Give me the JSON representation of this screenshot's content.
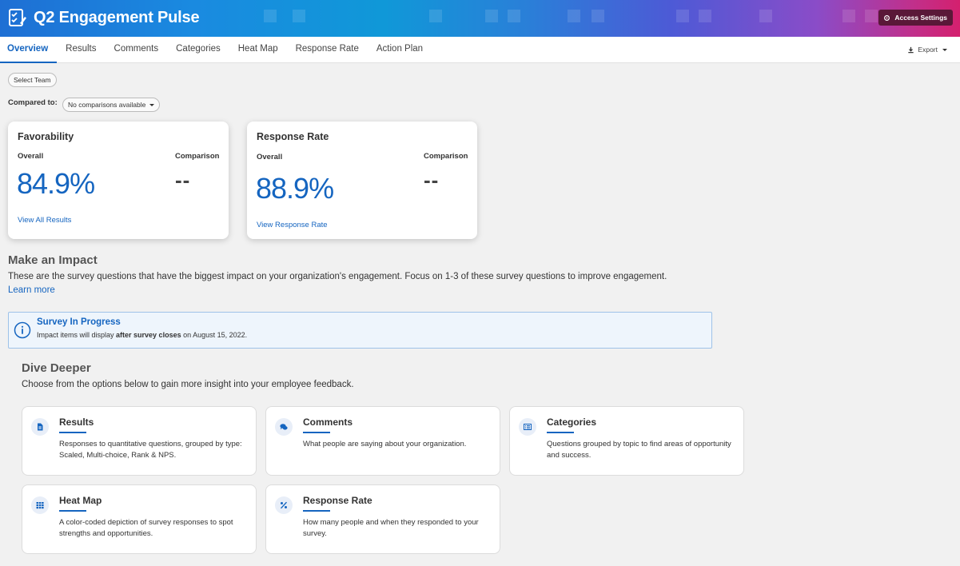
{
  "header": {
    "title": "Q2 Engagement Pulse",
    "logo_icon": "survey-check-icon",
    "access_settings_label": "Access Settings",
    "gradient_colors": [
      "#1e6fd4",
      "#1098d8",
      "#4d5ad6",
      "#8a4cc8",
      "#d4206e"
    ]
  },
  "nav": {
    "tabs": [
      {
        "label": "Overview",
        "active": true
      },
      {
        "label": "Results"
      },
      {
        "label": "Comments"
      },
      {
        "label": "Categories"
      },
      {
        "label": "Heat Map"
      },
      {
        "label": "Response Rate"
      },
      {
        "label": "Action Plan"
      }
    ],
    "export_label": "Export"
  },
  "controls": {
    "select_team_label": "Select Team",
    "compared_to_label": "Compared to:",
    "comparison_value": "No comparisons available"
  },
  "metrics": {
    "favorability": {
      "title": "Favorability",
      "overall_label": "Overall",
      "comparison_label": "Comparison",
      "overall_value": "84.9%",
      "comparison_value": "--",
      "link_label": "View All Results"
    },
    "response_rate": {
      "title": "Response Rate",
      "overall_label": "Overall",
      "comparison_label": "Comparison",
      "overall_value": "88.9%",
      "comparison_value": "--",
      "link_label": "View Response Rate"
    }
  },
  "impact": {
    "title": "Make an Impact",
    "description": "These are the survey questions that have the biggest impact on your organization's engagement. Focus on 1-3 of these survey questions to improve engagement.",
    "learn_more_label": "Learn more",
    "notice": {
      "icon": "info-icon",
      "title": "Survey In Progress",
      "text_before": "Impact items will display ",
      "text_bold": "after survey closes",
      "text_after": " on August 15, 2022."
    }
  },
  "dive": {
    "title": "Dive Deeper",
    "description": "Choose from the options below to gain more insight into your employee feedback.",
    "tiles": [
      {
        "icon": "document-icon",
        "title": "Results",
        "description": "Responses to quantitative questions, grouped by type: Scaled, Multi-choice, Rank & NPS."
      },
      {
        "icon": "chat-bubbles-icon",
        "title": "Comments",
        "description": "What people are saying about your organization."
      },
      {
        "icon": "list-icon",
        "title": "Categories",
        "description": "Questions grouped by topic to find areas of opportunity and success."
      },
      {
        "icon": "grid-icon",
        "title": "Heat Map",
        "description": "A color-coded depiction of survey responses to spot strengths and opportunities."
      },
      {
        "icon": "percent-icon",
        "title": "Response Rate",
        "description": "How many people and when they responded to your survey."
      }
    ]
  },
  "colors": {
    "accent": "#1565c0",
    "background": "#f1f1f1",
    "access_button": "#5a1838"
  }
}
